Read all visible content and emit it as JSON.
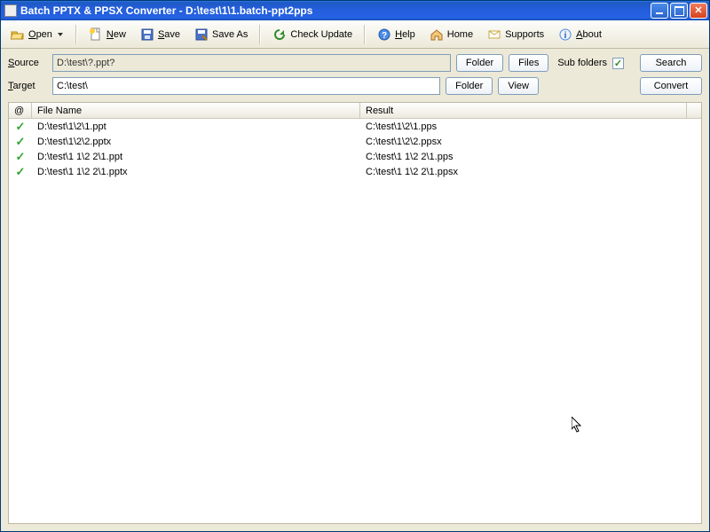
{
  "window": {
    "title": "Batch PPTX & PPSX Converter - D:\\test\\1\\1.batch-ppt2pps"
  },
  "toolbar": {
    "open": "Open",
    "new": "New",
    "save": "Save",
    "save_as": "Save As",
    "check_update": "Check Update",
    "help": "Help",
    "home": "Home",
    "supports": "Supports",
    "about": "About"
  },
  "form": {
    "source_label": "Source",
    "source_value": "D:\\test\\?.ppt?",
    "target_label": "Target",
    "target_value": "C:\\test\\",
    "folder_btn": "Folder",
    "files_btn": "Files",
    "view_btn": "View",
    "sub_folders_label": "Sub folders",
    "sub_folders_checked": true,
    "search_btn": "Search",
    "convert_btn": "Convert"
  },
  "list": {
    "headers": {
      "status": "@",
      "file": "File Name",
      "result": "Result"
    },
    "rows": [
      {
        "file": "D:\\test\\1\\2\\1.ppt",
        "result": "C:\\test\\1\\2\\1.pps"
      },
      {
        "file": "D:\\test\\1\\2\\2.pptx",
        "result": "C:\\test\\1\\2\\2.ppsx"
      },
      {
        "file": "D:\\test\\1 1\\2 2\\1.ppt",
        "result": "C:\\test\\1 1\\2 2\\1.pps"
      },
      {
        "file": "D:\\test\\1 1\\2 2\\1.pptx",
        "result": "C:\\test\\1 1\\2 2\\1.ppsx"
      }
    ]
  }
}
